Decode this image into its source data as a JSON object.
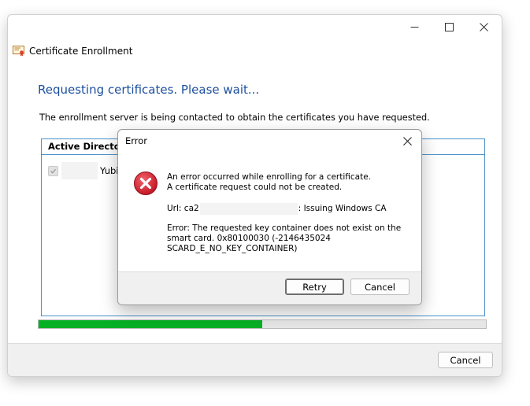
{
  "window": {
    "title": "Certificate Enrollment",
    "heading": "Requesting certificates. Please wait...",
    "description": "The enrollment server is being contacted to obtain the certificates you have requested.",
    "policy_header": "Active Directory",
    "policy_item_label": "Yubil",
    "progress_fraction": 0.5,
    "cancel_label": "Cancel",
    "icons": {
      "minimize": "minimize-icon",
      "maximize": "maximize-icon",
      "close": "close-icon",
      "app": "certificate-icon",
      "checkbox": "checkbox-checked"
    },
    "colors": {
      "heading": "#1c4f9e",
      "progress": "#06b025",
      "policy_border": "#4a90c8"
    }
  },
  "dialog": {
    "title": "Error",
    "message_line1": "An error occurred while enrolling for a certificate.",
    "message_line2": "A certificate request could not be created.",
    "url_prefix": "Url: ca2",
    "url_suffix": ": Issuing Windows CA",
    "error_line1": "Error: The requested key container does not exist on the",
    "error_line2": "smart card. 0x80100030 (-2146435024",
    "error_line3": "SCARD_E_NO_KEY_CONTAINER)",
    "retry_label": "Retry",
    "cancel_label": "Cancel",
    "icons": {
      "close": "close-icon",
      "error": "error-icon"
    },
    "colors": {
      "error_icon": "#d3202f"
    }
  }
}
